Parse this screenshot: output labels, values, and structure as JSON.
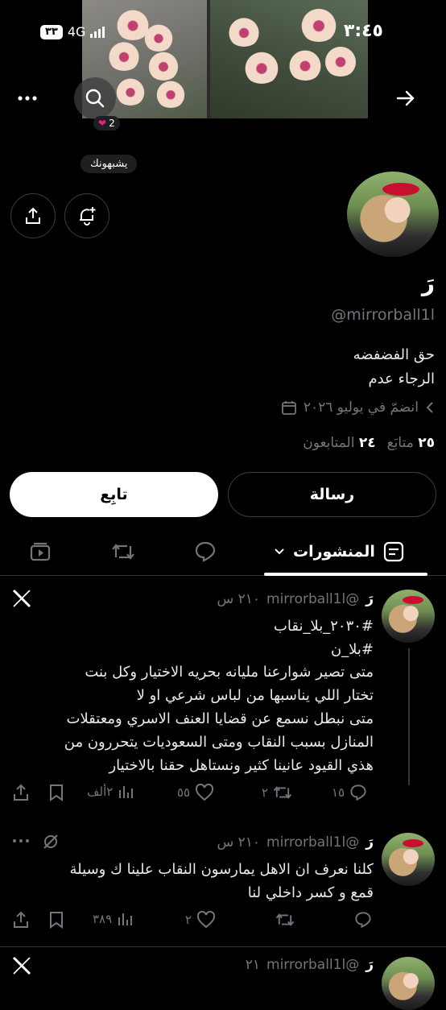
{
  "status_bar": {
    "time": "٣:٤٥",
    "network": "4G",
    "battery": "٣٣"
  },
  "header": {
    "badge_count": "2"
  },
  "lookalike_label": "يشبهونك",
  "profile": {
    "name": "رَ",
    "handle": "@mirrorball1l",
    "bio_line1": "حق الفضفضه",
    "bio_line2": "الرجاء عدم",
    "joined": "انضمّ في يوليو ٢٠٢٦",
    "following_count": "٢٥",
    "following_label": "متابَع",
    "followers_count": "٢٤",
    "followers_label": "المتابعون"
  },
  "buttons": {
    "follow": "تابِع",
    "message": "رسالة"
  },
  "tabs": {
    "posts": "المنشورات"
  },
  "tweets": [
    {
      "name": "رَ",
      "handle": "@mirrorball1l",
      "time": "٢١٠ س",
      "hashtag1": "#٢٠٣٠_بلا_نقاب",
      "hashtag2": "#بلا_ن",
      "lines": [
        "متى تصير شوارعنا مليانه بحريه الاختيار وكل بنت",
        "تختار اللي يناسبها من لباس شرعي او لا",
        "متى نبطل نسمع عن قضايا العنف الاسري ومعتقلات",
        "المنازل بسبب النقاب ومتى السعوديات  يتحررون من",
        "هذي القيود عانينا كثير ونستاهل حقنا بالاختيار"
      ],
      "replies": "١٥",
      "reposts": "٢",
      "likes": "٥٥",
      "views": "٢ألف"
    },
    {
      "name": "رَ",
      "handle": "@mirrorball1l",
      "time": "٢١٠ س",
      "lines": [
        "كلنا نعرف ان الاهل يمارسون النقاب علينا ك وسيلة",
        "قمع و كسر داخلي لنا"
      ],
      "replies": "",
      "reposts": "",
      "likes": "٢",
      "views": "٣٨٩"
    }
  ],
  "peek_tweet": {
    "name": "رَ",
    "handle": "@mirrorball1l",
    "time": "٢١"
  }
}
